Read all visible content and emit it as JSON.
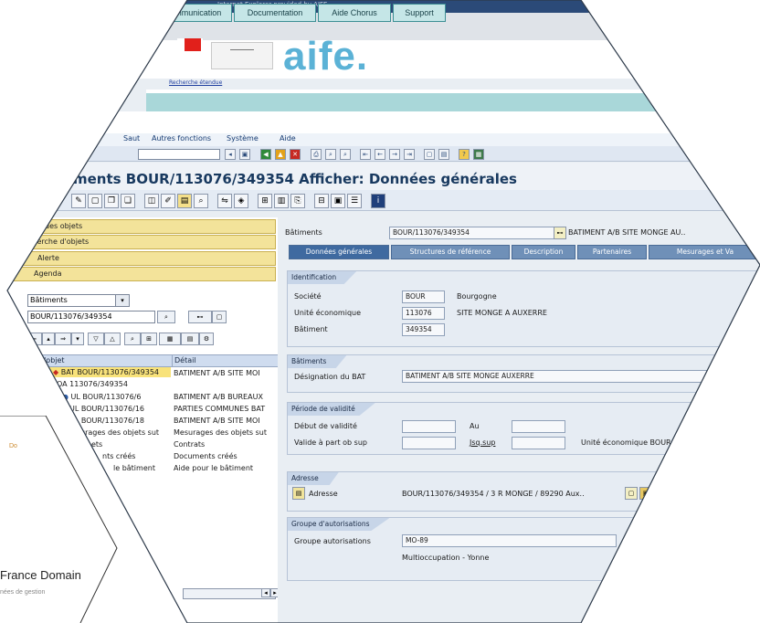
{
  "background": {
    "left_card_tag": "Do",
    "left_title": "France Domain",
    "left_subtitle": "nées de gestion"
  },
  "browser": {
    "title": "Internet Explorer provided by AIFE"
  },
  "portal": {
    "logo_text": "aife.",
    "search_link": "Recherche étendue",
    "tabs": [
      "Communication",
      "Documentation",
      "Aide Chorus",
      "Support"
    ]
  },
  "sap": {
    "menu": [
      "Saut",
      "Autres fonctions",
      "Système",
      "Aide"
    ],
    "title": "ments BOUR/113076/349354 Afficher: Données générales",
    "left_panel": {
      "items": [
        "des objets",
        "cherche d'objets",
        "Alerte",
        "Agenda"
      ],
      "object_type": "Bâtiments",
      "object_id": "BOUR/113076/349354",
      "table_headers": [
        "m de l'objet",
        "Détail"
      ],
      "rows": [
        {
          "obj": "BAT BOUR/113076/349354",
          "detail": "BATIMENT A/B SITE MOI"
        },
        {
          "obj": "OA 113076/349354",
          "detail": ""
        },
        {
          "obj": "UL BOUR/113076/6",
          "detail": "BATIMENT A/B BUREAUX"
        },
        {
          "obj": "UL BOUR/113076/16",
          "detail": "PARTIES COMMUNES BAT"
        },
        {
          "obj": "UL BOUR/113076/18",
          "detail": "BATIMENT A/B SITE MOI"
        },
        {
          "obj": "urages des objets sut",
          "detail": "Mesurages des objets sut"
        },
        {
          "obj": "ets",
          "detail": "Contrats"
        },
        {
          "obj": "nts créés",
          "detail": "Documents créés"
        },
        {
          "obj": "le bâtiment",
          "detail": "Aide pour le bâtiment"
        }
      ]
    },
    "right_panel": {
      "header_label": "Bâtiments",
      "header_value": "BOUR/113076/349354",
      "header_desc": "BATIMENT A/B SITE MONGE AU..",
      "tabs": [
        "Données générales",
        "Structures de référence",
        "Description",
        "Partenaires",
        "Mesurages et Va"
      ],
      "identification": {
        "title": "Identification",
        "societe_label": "Société",
        "societe_value": "BOUR",
        "societe_text": "Bourgogne",
        "ue_label": "Unité économique",
        "ue_value": "113076",
        "ue_text": "SITE MONGE A AUXERRE",
        "bat_label": "Bâtiment",
        "bat_value": "349354"
      },
      "batiments": {
        "title": "Bâtiments",
        "desig_label": "Désignation du BAT",
        "desig_value": "BATIMENT A/B SITE MONGE AUXERRE"
      },
      "validite": {
        "title": "Période de validité",
        "debut_label": "Début de validité",
        "au_label": "Au",
        "valide_label": "Valide à part ob sup",
        "jsq_label": "Jsq.sup",
        "ue_label": "Unité économique BOUR/"
      },
      "adresse": {
        "title": "Adresse",
        "label": "Adresse",
        "value": "BOUR/113076/349354 / 3 R MONGE / 89290 Aux.."
      },
      "autorisations": {
        "title": "Groupe d'autorisations",
        "label": "Groupe autorisations",
        "value": "MO-89",
        "text": "Multioccupation - Yonne"
      }
    }
  }
}
